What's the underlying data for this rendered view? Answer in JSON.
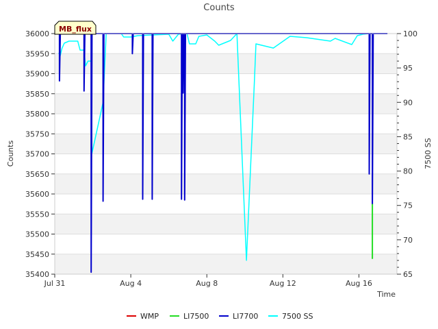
{
  "chart_data": {
    "type": "line",
    "title": "Counts",
    "xlabel": "Time",
    "ylabel": "Counts",
    "y2label": "7500 SS",
    "annotation": "MB_flux",
    "x_range": [
      "2023-07-31",
      "2023-08-18"
    ],
    "x_ticks": [
      {
        "date": "2023-07-31",
        "label": "Jul 31"
      },
      {
        "date": "2023-08-04",
        "label": "Aug 4"
      },
      {
        "date": "2023-08-08",
        "label": "Aug 8"
      },
      {
        "date": "2023-08-12",
        "label": "Aug 12"
      },
      {
        "date": "2023-08-16",
        "label": "Aug 16"
      }
    ],
    "ylim": [
      35400,
      36000
    ],
    "y_ticks": [
      35400,
      35450,
      35500,
      35550,
      35600,
      35650,
      35700,
      35750,
      35800,
      35850,
      35900,
      35950,
      36000
    ],
    "y2lim": [
      65,
      100
    ],
    "y2_ticks": [
      65,
      70,
      75,
      80,
      85,
      90,
      95,
      100
    ],
    "grid": true,
    "legend_position": "bottom",
    "series": [
      {
        "name": "WMP",
        "color": "#dd0000",
        "axis": "left",
        "points": []
      },
      {
        "name": "LI7500",
        "color": "#22dd22",
        "axis": "left",
        "points": [
          [
            "2023-08-16 17:00",
            35575
          ],
          [
            "2023-08-16 17:00",
            35438
          ]
        ]
      },
      {
        "name": "LI7700",
        "color": "#0000cc",
        "axis": "left",
        "points": [
          [
            "2023-07-31 00:00",
            36000
          ],
          [
            "2023-07-31 06:00",
            36000
          ],
          [
            "2023-07-31 06:00",
            35882
          ],
          [
            "2023-07-31 07:00",
            36000
          ],
          [
            "2023-08-01 13:00",
            36000
          ],
          [
            "2023-08-01 13:00",
            35857
          ],
          [
            "2023-08-01 14:00",
            36000
          ],
          [
            "2023-08-01 22:00",
            36000
          ],
          [
            "2023-08-01 22:00",
            35405
          ],
          [
            "2023-08-01 23:00",
            36000
          ],
          [
            "2023-08-02 13:00",
            36000
          ],
          [
            "2023-08-02 13:00",
            35582
          ],
          [
            "2023-08-02 14:00",
            36000
          ],
          [
            "2023-08-04 02:00",
            36000
          ],
          [
            "2023-08-04 02:00",
            35950
          ],
          [
            "2023-08-04 03:00",
            36000
          ],
          [
            "2023-08-04 15:00",
            36000
          ],
          [
            "2023-08-04 15:00",
            35587
          ],
          [
            "2023-08-04 16:00",
            36000
          ],
          [
            "2023-08-05 03:00",
            36000
          ],
          [
            "2023-08-05 03:00",
            35587
          ],
          [
            "2023-08-05 04:00",
            36000
          ],
          [
            "2023-08-06 16:00",
            36000
          ],
          [
            "2023-08-06 16:00",
            35587
          ],
          [
            "2023-08-06 17:00",
            36000
          ],
          [
            "2023-08-06 18:00",
            36000
          ],
          [
            "2023-08-06 18:00",
            35852
          ],
          [
            "2023-08-06 19:00",
            36000
          ],
          [
            "2023-08-06 20:00",
            36000
          ],
          [
            "2023-08-06 20:00",
            35585
          ],
          [
            "2023-08-06 21:00",
            36000
          ],
          [
            "2023-08-16 13:00",
            36000
          ],
          [
            "2023-08-16 13:00",
            35650
          ],
          [
            "2023-08-16 14:00",
            36000
          ],
          [
            "2023-08-16 17:00",
            36000
          ],
          [
            "2023-08-16 17:00",
            35575
          ],
          [
            "2023-08-16 18:00",
            36000
          ],
          [
            "2023-08-17 12:00",
            36000
          ]
        ]
      },
      {
        "name": "7500 SS",
        "color": "#00ffff",
        "axis": "right",
        "points": [
          [
            "2023-07-31 05:00",
            97.2
          ],
          [
            "2023-07-31 07:00",
            96.8
          ],
          [
            "2023-07-31 09:00",
            97.8
          ],
          [
            "2023-07-31 12:00",
            98.6
          ],
          [
            "2023-07-31 18:00",
            98.9
          ],
          [
            "2023-08-01 05:00",
            98.9
          ],
          [
            "2023-08-01 08:00",
            97.6
          ],
          [
            "2023-08-01 13:00",
            97.6
          ],
          [
            "2023-08-01 15:00",
            95.3
          ],
          [
            "2023-08-01 18:00",
            96.0
          ],
          [
            "2023-08-01 22:00",
            96.0
          ],
          [
            "2023-08-01 23:00",
            82.6
          ],
          [
            "2023-08-02 13:00",
            90.0
          ],
          [
            "2023-08-02 17:00",
            100.0
          ],
          [
            "2023-08-03 12:00",
            100.0
          ],
          [
            "2023-08-03 15:00",
            99.5
          ],
          [
            "2023-08-04 00:00",
            99.5
          ],
          [
            "2023-08-04 09:00",
            99.7
          ],
          [
            "2023-08-05 03:00",
            99.8
          ],
          [
            "2023-08-06 00:00",
            99.9
          ],
          [
            "2023-08-06 05:00",
            98.9
          ],
          [
            "2023-08-06 12:00",
            99.9
          ],
          [
            "2023-08-06 23:00",
            100.0
          ],
          [
            "2023-08-07 02:00",
            98.5
          ],
          [
            "2023-08-07 10:00",
            98.5
          ],
          [
            "2023-08-07 14:00",
            99.6
          ],
          [
            "2023-08-08 00:00",
            99.8
          ],
          [
            "2023-08-08 10:00",
            98.9
          ],
          [
            "2023-08-08 15:00",
            98.3
          ],
          [
            "2023-08-09 06:00",
            99.0
          ],
          [
            "2023-08-09 14:00",
            100.0
          ],
          [
            "2023-08-10 02:00",
            67.0
          ],
          [
            "2023-08-10 12:00",
            93.0
          ],
          [
            "2023-08-10 14:00",
            98.5
          ],
          [
            "2023-08-11 12:00",
            97.9
          ],
          [
            "2023-08-12 09:00",
            99.6
          ],
          [
            "2023-08-13 06:00",
            99.4
          ],
          [
            "2023-08-14 12:00",
            98.9
          ],
          [
            "2023-08-14 18:00",
            99.3
          ],
          [
            "2023-08-15 15:00",
            98.4
          ],
          [
            "2023-08-15 22:00",
            99.7
          ],
          [
            "2023-08-16 05:00",
            99.9
          ],
          [
            "2023-08-16 13:00",
            100.0
          ]
        ]
      }
    ]
  }
}
